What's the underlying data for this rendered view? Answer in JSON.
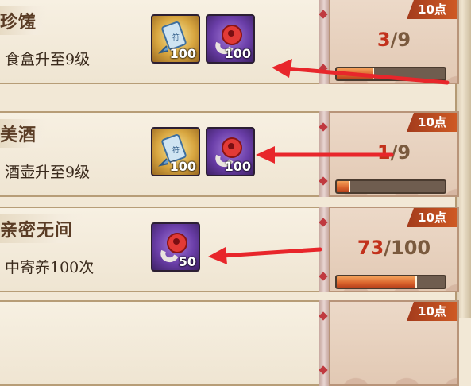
{
  "colors": {
    "accent_red": "#c2311b",
    "badge": "#b8421c",
    "arrow": "#e8262b"
  },
  "tasks": [
    {
      "title": "珍馐",
      "desc": "食盒升至9级",
      "points": "10点",
      "current": "3",
      "total": "/9",
      "progress": 0.33,
      "rewards": [
        {
          "icon": "scroll-icon",
          "count": "100"
        },
        {
          "icon": "red-magatama-icon",
          "count": "100"
        }
      ]
    },
    {
      "title": "美酒",
      "desc": "酒壶升至9级",
      "points": "10点",
      "current": "1",
      "total": "/9",
      "progress": 0.11,
      "rewards": [
        {
          "icon": "scroll-icon",
          "count": "100"
        },
        {
          "icon": "red-magatama-icon",
          "count": "100"
        }
      ]
    },
    {
      "title": "亲密无间",
      "desc": "中寄养100次",
      "points": "10点",
      "current": "73",
      "total": "/100",
      "progress": 0.73,
      "rewards": [
        {
          "icon": "red-magatama-icon",
          "count": "50"
        }
      ]
    },
    {
      "title": "",
      "desc": "",
      "points": "10点",
      "current": "",
      "total": "",
      "progress": 0,
      "rewards": []
    }
  ]
}
